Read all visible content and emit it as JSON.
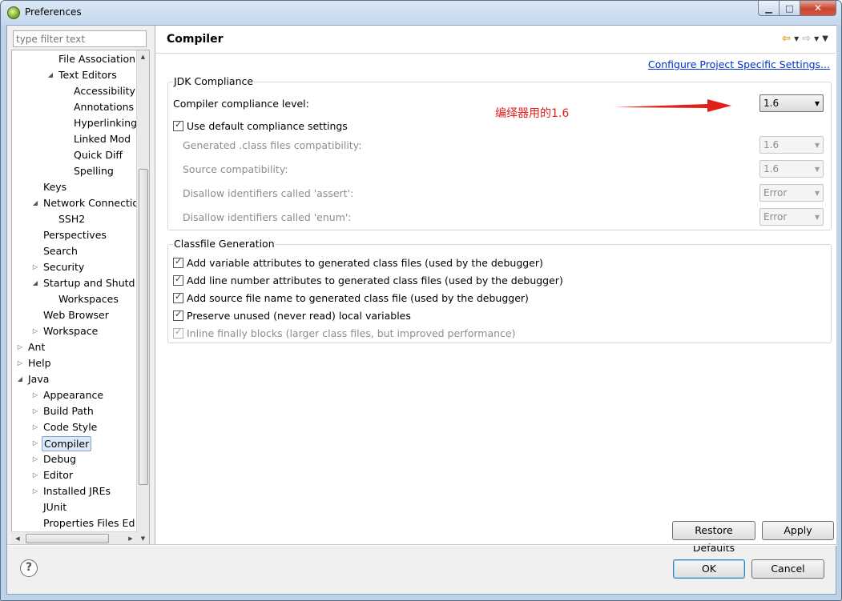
{
  "window": {
    "title": "Preferences",
    "min_icon": "minimize-icon",
    "max_icon": "maximize-icon",
    "close_icon": "close-icon",
    "min_glyph": "▁",
    "max_glyph": "□",
    "close_glyph": "✕"
  },
  "sidebar": {
    "filter_placeholder": "type filter text",
    "items": [
      {
        "label": "File Association",
        "indent": 3,
        "twisty": "",
        "selected": false
      },
      {
        "label": "Text Editors",
        "indent": 3,
        "twisty": "expanded",
        "selected": false
      },
      {
        "label": "Accessibility",
        "indent": 4,
        "twisty": "",
        "selected": false
      },
      {
        "label": "Annotations",
        "indent": 4,
        "twisty": "",
        "selected": false
      },
      {
        "label": "Hyperlinking",
        "indent": 4,
        "twisty": "",
        "selected": false
      },
      {
        "label": "Linked Mod",
        "indent": 4,
        "twisty": "",
        "selected": false
      },
      {
        "label": "Quick Diff",
        "indent": 4,
        "twisty": "",
        "selected": false
      },
      {
        "label": "Spelling",
        "indent": 4,
        "twisty": "",
        "selected": false
      },
      {
        "label": "Keys",
        "indent": 2,
        "twisty": "",
        "selected": false
      },
      {
        "label": "Network Connectio",
        "indent": 2,
        "twisty": "expanded",
        "selected": false
      },
      {
        "label": "SSH2",
        "indent": 3,
        "twisty": "",
        "selected": false
      },
      {
        "label": "Perspectives",
        "indent": 2,
        "twisty": "",
        "selected": false
      },
      {
        "label": "Search",
        "indent": 2,
        "twisty": "",
        "selected": false
      },
      {
        "label": "Security",
        "indent": 2,
        "twisty": "collapsed",
        "selected": false
      },
      {
        "label": "Startup and Shutd",
        "indent": 2,
        "twisty": "expanded",
        "selected": false
      },
      {
        "label": "Workspaces",
        "indent": 3,
        "twisty": "",
        "selected": false
      },
      {
        "label": "Web Browser",
        "indent": 2,
        "twisty": "",
        "selected": false
      },
      {
        "label": "Workspace",
        "indent": 2,
        "twisty": "collapsed",
        "selected": false
      },
      {
        "label": "Ant",
        "indent": 1,
        "twisty": "collapsed",
        "selected": false
      },
      {
        "label": "Help",
        "indent": 1,
        "twisty": "collapsed",
        "selected": false
      },
      {
        "label": "Java",
        "indent": 1,
        "twisty": "expanded",
        "selected": false
      },
      {
        "label": "Appearance",
        "indent": 2,
        "twisty": "collapsed",
        "selected": false
      },
      {
        "label": "Build Path",
        "indent": 2,
        "twisty": "collapsed",
        "selected": false
      },
      {
        "label": "Code Style",
        "indent": 2,
        "twisty": "collapsed",
        "selected": false
      },
      {
        "label": "Compiler",
        "indent": 2,
        "twisty": "collapsed",
        "selected": true
      },
      {
        "label": "Debug",
        "indent": 2,
        "twisty": "collapsed",
        "selected": false
      },
      {
        "label": "Editor",
        "indent": 2,
        "twisty": "collapsed",
        "selected": false
      },
      {
        "label": "Installed JREs",
        "indent": 2,
        "twisty": "collapsed",
        "selected": false
      },
      {
        "label": "JUnit",
        "indent": 2,
        "twisty": "",
        "selected": false
      },
      {
        "label": "Properties Files Ed",
        "indent": 2,
        "twisty": "",
        "selected": false
      }
    ]
  },
  "main": {
    "title": "Compiler",
    "nav": {
      "back_icon": "back-arrow-icon",
      "forward_icon": "forward-arrow-icon",
      "menu_icon": "view-menu-icon",
      "back_glyph": "⇦",
      "forward_glyph": "⇨",
      "dropdown_glyph": "▼"
    },
    "config_link": "Configure Project Specific Settings...",
    "jdk": {
      "group_title": "JDK Compliance",
      "compliance_label": "Compiler compliance level:",
      "compliance_value": "1.6",
      "use_default_label": "Use default compliance settings",
      "use_default_checked": true,
      "rows": [
        {
          "label": "Generated .class files compatibility:",
          "value": "1.6"
        },
        {
          "label": "Source compatibility:",
          "value": "1.6"
        },
        {
          "label": "Disallow identifiers called 'assert':",
          "value": "Error"
        },
        {
          "label": "Disallow identifiers called 'enum':",
          "value": "Error"
        }
      ]
    },
    "classfile": {
      "group_title": "Classfile Generation",
      "options": [
        {
          "label": "Add variable attributes to generated class files (used by the debugger)",
          "checked": true,
          "disabled": false
        },
        {
          "label": "Add line number attributes to generated class files (used by the debugger)",
          "checked": true,
          "disabled": false
        },
        {
          "label": "Add source file name to generated class file (used by the debugger)",
          "checked": true,
          "disabled": false
        },
        {
          "label": "Preserve unused (never read) local variables",
          "checked": true,
          "disabled": false
        },
        {
          "label": "Inline finally blocks (larger class files, but improved performance)",
          "checked": true,
          "disabled": true
        }
      ]
    },
    "annotation": "编绎器用的1.6",
    "annotation_color": "#e2201b",
    "restore_defaults": "Restore Defaults",
    "apply": "Apply"
  },
  "footer": {
    "help_icon": "help-icon",
    "help_glyph": "?",
    "ok": "OK",
    "cancel": "Cancel"
  }
}
